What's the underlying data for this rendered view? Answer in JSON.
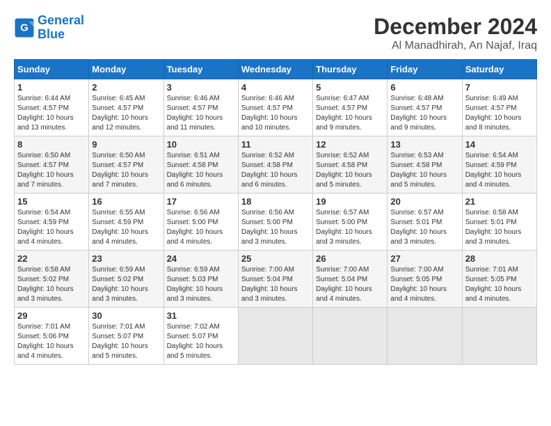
{
  "logo": {
    "line1": "General",
    "line2": "Blue"
  },
  "title": "December 2024",
  "subtitle": "Al Manadhirah, An Najaf, Iraq",
  "headers": [
    "Sunday",
    "Monday",
    "Tuesday",
    "Wednesday",
    "Thursday",
    "Friday",
    "Saturday"
  ],
  "weeks": [
    [
      {
        "day": "1",
        "rise": "6:44 AM",
        "set": "4:57 PM",
        "daylight": "10 hours and 13 minutes."
      },
      {
        "day": "2",
        "rise": "6:45 AM",
        "set": "4:57 PM",
        "daylight": "10 hours and 12 minutes."
      },
      {
        "day": "3",
        "rise": "6:46 AM",
        "set": "4:57 PM",
        "daylight": "10 hours and 11 minutes."
      },
      {
        "day": "4",
        "rise": "6:46 AM",
        "set": "4:57 PM",
        "daylight": "10 hours and 10 minutes."
      },
      {
        "day": "5",
        "rise": "6:47 AM",
        "set": "4:57 PM",
        "daylight": "10 hours and 9 minutes."
      },
      {
        "day": "6",
        "rise": "6:48 AM",
        "set": "4:57 PM",
        "daylight": "10 hours and 9 minutes."
      },
      {
        "day": "7",
        "rise": "6:49 AM",
        "set": "4:57 PM",
        "daylight": "10 hours and 8 minutes."
      }
    ],
    [
      {
        "day": "8",
        "rise": "6:50 AM",
        "set": "4:57 PM",
        "daylight": "10 hours and 7 minutes."
      },
      {
        "day": "9",
        "rise": "6:50 AM",
        "set": "4:57 PM",
        "daylight": "10 hours and 7 minutes."
      },
      {
        "day": "10",
        "rise": "6:51 AM",
        "set": "4:58 PM",
        "daylight": "10 hours and 6 minutes."
      },
      {
        "day": "11",
        "rise": "6:52 AM",
        "set": "4:58 PM",
        "daylight": "10 hours and 6 minutes."
      },
      {
        "day": "12",
        "rise": "6:52 AM",
        "set": "4:58 PM",
        "daylight": "10 hours and 5 minutes."
      },
      {
        "day": "13",
        "rise": "6:53 AM",
        "set": "4:58 PM",
        "daylight": "10 hours and 5 minutes."
      },
      {
        "day": "14",
        "rise": "6:54 AM",
        "set": "4:59 PM",
        "daylight": "10 hours and 4 minutes."
      }
    ],
    [
      {
        "day": "15",
        "rise": "6:54 AM",
        "set": "4:59 PM",
        "daylight": "10 hours and 4 minutes."
      },
      {
        "day": "16",
        "rise": "6:55 AM",
        "set": "4:59 PM",
        "daylight": "10 hours and 4 minutes."
      },
      {
        "day": "17",
        "rise": "6:56 AM",
        "set": "5:00 PM",
        "daylight": "10 hours and 4 minutes."
      },
      {
        "day": "18",
        "rise": "6:56 AM",
        "set": "5:00 PM",
        "daylight": "10 hours and 3 minutes."
      },
      {
        "day": "19",
        "rise": "6:57 AM",
        "set": "5:00 PM",
        "daylight": "10 hours and 3 minutes."
      },
      {
        "day": "20",
        "rise": "6:57 AM",
        "set": "5:01 PM",
        "daylight": "10 hours and 3 minutes."
      },
      {
        "day": "21",
        "rise": "6:58 AM",
        "set": "5:01 PM",
        "daylight": "10 hours and 3 minutes."
      }
    ],
    [
      {
        "day": "22",
        "rise": "6:58 AM",
        "set": "5:02 PM",
        "daylight": "10 hours and 3 minutes."
      },
      {
        "day": "23",
        "rise": "6:59 AM",
        "set": "5:02 PM",
        "daylight": "10 hours and 3 minutes."
      },
      {
        "day": "24",
        "rise": "6:59 AM",
        "set": "5:03 PM",
        "daylight": "10 hours and 3 minutes."
      },
      {
        "day": "25",
        "rise": "7:00 AM",
        "set": "5:04 PM",
        "daylight": "10 hours and 3 minutes."
      },
      {
        "day": "26",
        "rise": "7:00 AM",
        "set": "5:04 PM",
        "daylight": "10 hours and 4 minutes."
      },
      {
        "day": "27",
        "rise": "7:00 AM",
        "set": "5:05 PM",
        "daylight": "10 hours and 4 minutes."
      },
      {
        "day": "28",
        "rise": "7:01 AM",
        "set": "5:05 PM",
        "daylight": "10 hours and 4 minutes."
      }
    ],
    [
      {
        "day": "29",
        "rise": "7:01 AM",
        "set": "5:06 PM",
        "daylight": "10 hours and 4 minutes."
      },
      {
        "day": "30",
        "rise": "7:01 AM",
        "set": "5:07 PM",
        "daylight": "10 hours and 5 minutes."
      },
      {
        "day": "31",
        "rise": "7:02 AM",
        "set": "5:07 PM",
        "daylight": "10 hours and 5 minutes."
      },
      null,
      null,
      null,
      null
    ]
  ],
  "labels": {
    "sunrise": "Sunrise:",
    "sunset": "Sunset:",
    "daylight": "Daylight:"
  }
}
